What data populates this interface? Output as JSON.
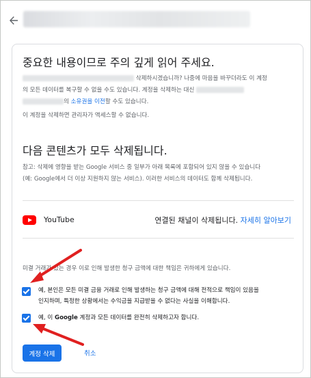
{
  "header": {
    "back_icon": "arrow-left-icon"
  },
  "notice": {
    "title": "중요한 내용이므로 주의 깊게 읽어 주세요.",
    "line1_suffix": "삭제하시겠습니까? 나중에 마음을 바꾸더라도 이 계정",
    "line2_a": "의 모든 데이터를 복구할 수 없을 수도 있습니다. 계정을 삭제하는 대신",
    "line3_a": "의 ",
    "line3_link": "소유권을 이전",
    "line3_b": "할 수도 있습니다.",
    "admin_note": "이 계정을 삭제하면 관리자가 액세스할 수 없습니다."
  },
  "deleted_content": {
    "title": "다음 콘텐츠가 모두 삭제됩니다.",
    "ref_line1": "참고: 삭제에 영향을 받는 Google 서비스 중 일부가 아래 목록에 포함되어 있지 않을 수 있습니다",
    "ref_line2": "(예: Google에서 더 이상 지원하지 않는 서비스). 이러한 서비스의 데이터도 함께 삭제됩니다.",
    "service": {
      "name": "YouTube",
      "icon": "youtube-icon",
      "status": "연결된 채널이 삭제됩니다.",
      "link": "자세히 알아보기"
    }
  },
  "confirm": {
    "warning": "미결 거래가 있는 경우 이로 인해 발생한 청구 금액에 대한 책임은 귀하에게 있습니다.",
    "check1_line1": "예, 본인은 모든 미결 금융 거래로 인해 발생하는 청구 금액에 대해 전적으로 책임이 있음을",
    "check1_line2": "인지하며, 특정한 상황에서는 수익금을 지급받을 수 없다는 사실을 이해합니다.",
    "check1_checked": true,
    "check2_a": "예, 이 ",
    "check2_bold": "Google",
    "check2_b": " 계정과 모든 데이터를 완전히 삭제하고자 합니다.",
    "check2_checked": true
  },
  "actions": {
    "delete_label": "계정 삭제",
    "cancel_label": "취소"
  },
  "colors": {
    "accent": "#1a73e8",
    "annotation": "#e02020",
    "youtube": "#ff0000"
  }
}
